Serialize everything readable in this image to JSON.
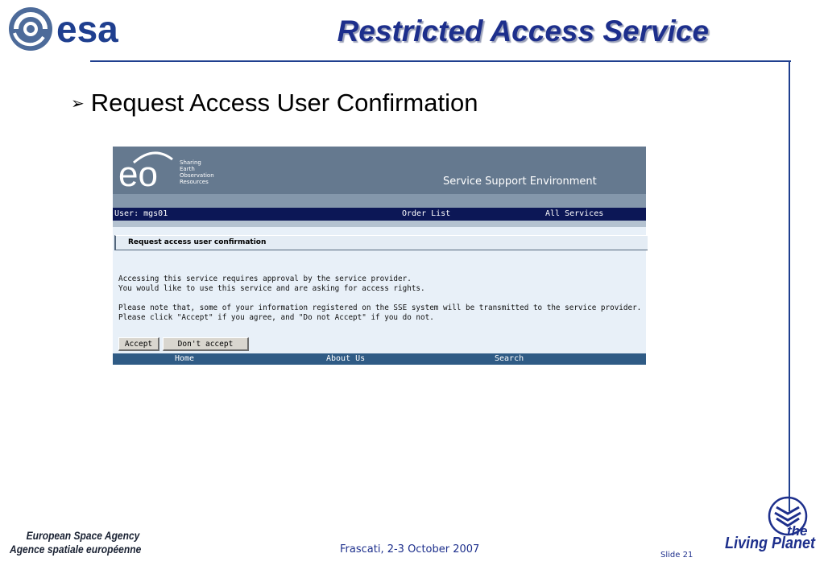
{
  "slide": {
    "logo_text": "esa",
    "title": "Restricted Access Service",
    "bullet": "Request Access User Confirmation",
    "footer": {
      "agency_en": "European Space Agency",
      "agency_fr": "Agence spatiale européenne",
      "date": "Frascati, 2-3 October 2007",
      "slide_number": "Slide 21",
      "brand_the": "the",
      "brand_living_planet": "Living Planet"
    },
    "colors": {
      "accent": "#1d2f8c",
      "frame": "#1f3f8f"
    }
  },
  "screenshot": {
    "header": {
      "logo_text": "eo",
      "tagline": [
        "Sharing",
        "Earth",
        "Observation",
        "Resources"
      ],
      "title": "Service Support Environment"
    },
    "userbar": {
      "user": "User: mgs01",
      "order_list": "Order List",
      "all_services": "All Services"
    },
    "section_title": "Request access user confirmation",
    "messages": [
      "Accessing this service requires approval by the service provider.",
      "You would like to use this service and are asking for access rights.",
      "Please note that, some of your information registered on the SSE system will be transmitted to the service provider.",
      "Please click \"Accept\" if you agree, and \"Do not Accept\" if you do not."
    ],
    "buttons": {
      "accept": "Accept",
      "dont_accept": "Don't accept"
    },
    "footer_nav": {
      "home": "Home",
      "about": "About Us",
      "search": "Search"
    },
    "colors": {
      "header": "#65798f",
      "userbar": "#0c1756",
      "footer": "#2f5b85",
      "body": "#e8f0f8"
    }
  }
}
